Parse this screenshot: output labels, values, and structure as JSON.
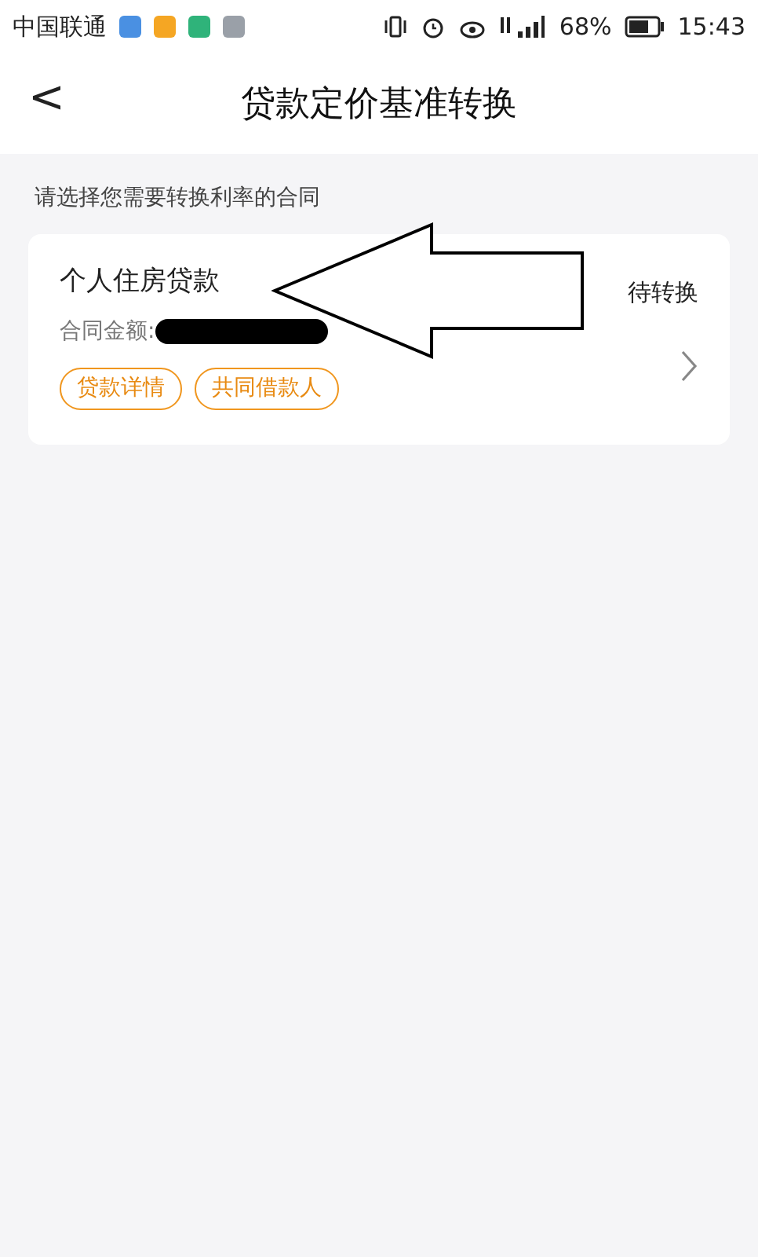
{
  "status_bar": {
    "carrier": "中国联通",
    "battery_percent": "68%",
    "time": "15:43"
  },
  "header": {
    "back": "<",
    "title": "贷款定价基准转换"
  },
  "prompt": "请选择您需要转换利率的合同",
  "contracts": [
    {
      "name": "个人住房贷款",
      "amount_label": "合同金额:",
      "status": "待转换",
      "actions": [
        "贷款详情",
        "共同借款人"
      ]
    }
  ]
}
